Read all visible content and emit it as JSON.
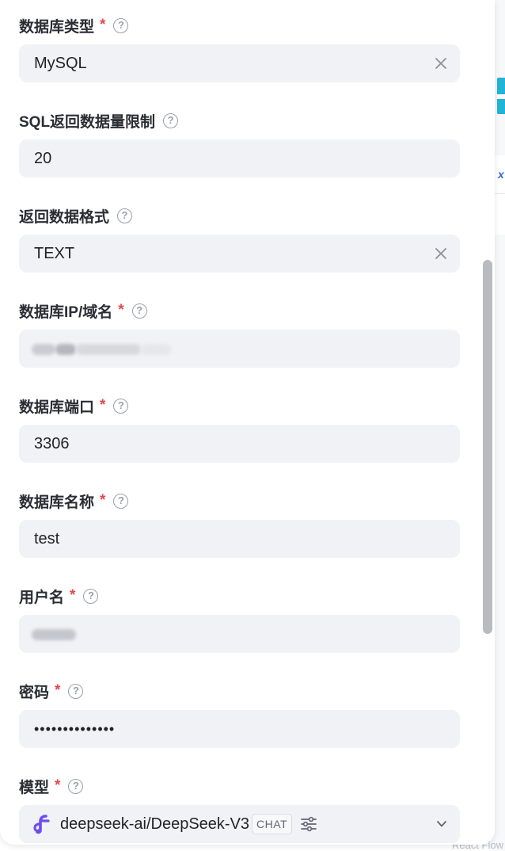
{
  "form": {
    "db_type": {
      "label": "数据库类型",
      "required": "*",
      "help": "?",
      "value": "MySQL"
    },
    "sql_limit": {
      "label": "SQL返回数据量限制",
      "help": "?",
      "value": "20"
    },
    "return_format": {
      "label": "返回数据格式",
      "help": "?",
      "value": "TEXT"
    },
    "db_host": {
      "label": "数据库IP/域名",
      "required": "*",
      "help": "?",
      "value": ""
    },
    "db_port": {
      "label": "数据库端口",
      "required": "*",
      "help": "?",
      "value": "3306"
    },
    "db_name": {
      "label": "数据库名称",
      "required": "*",
      "help": "?",
      "value": "test"
    },
    "username": {
      "label": "用户名",
      "required": "*",
      "help": "?",
      "value": ""
    },
    "password": {
      "label": "密码",
      "required": "*",
      "help": "?",
      "value": "••••••••••••••"
    },
    "model": {
      "label": "模型",
      "required": "*",
      "help": "?",
      "value": "deepseek-ai/DeepSeek-V3",
      "badge": "CHAT"
    }
  },
  "background": {
    "watermark": "React Flow"
  },
  "colors": {
    "required": "#e5484d",
    "input_bg": "#f1f2f6",
    "model_logo": "#6c4cf1"
  },
  "icons": [
    "help-icon",
    "clear-icon",
    "deepseek-logo-icon",
    "settings-sliders-icon",
    "chevron-down-icon"
  ]
}
